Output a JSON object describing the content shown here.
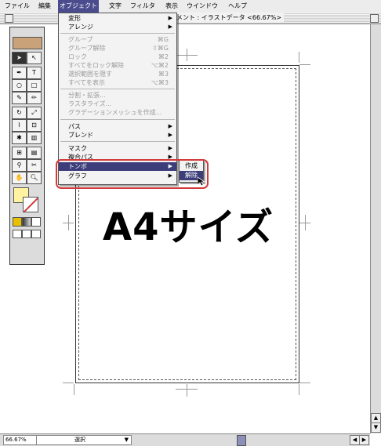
{
  "menubar": {
    "items": [
      {
        "label": "ファイル"
      },
      {
        "label": "編集"
      },
      {
        "label": "オブジェクト"
      },
      {
        "label": "文字"
      },
      {
        "label": "フィルタ"
      },
      {
        "label": "表示"
      },
      {
        "label": "ウインドウ"
      },
      {
        "label": "ヘルプ"
      }
    ]
  },
  "window": {
    "title": "ドキュメント : イラストデータ <66.67%>"
  },
  "menu": {
    "items": [
      {
        "label": "変形",
        "shortcut": "",
        "submenu": true,
        "enabled": true
      },
      {
        "label": "アレンジ",
        "shortcut": "",
        "submenu": true,
        "enabled": true
      },
      {
        "label": "グループ",
        "shortcut": "⌘G",
        "submenu": false,
        "enabled": false
      },
      {
        "label": "グループ解除",
        "shortcut": "⇧⌘G",
        "submenu": false,
        "enabled": false
      },
      {
        "label": "ロック",
        "shortcut": "⌘2",
        "submenu": false,
        "enabled": false
      },
      {
        "label": "すべてをロック解除",
        "shortcut": "⌥⌘2",
        "submenu": false,
        "enabled": false
      },
      {
        "label": "選択範囲を隠す",
        "shortcut": "⌘3",
        "submenu": false,
        "enabled": false
      },
      {
        "label": "すべてを表示",
        "shortcut": "⌥⌘3",
        "submenu": false,
        "enabled": false
      },
      {
        "label": "分割・拡張...",
        "shortcut": "",
        "submenu": false,
        "enabled": false
      },
      {
        "label": "ラスタライズ...",
        "shortcut": "",
        "submenu": false,
        "enabled": false
      },
      {
        "label": "グラデーションメッシュを作成...",
        "shortcut": "",
        "submenu": false,
        "enabled": false
      },
      {
        "label": "パス",
        "shortcut": "",
        "submenu": true,
        "enabled": true
      },
      {
        "label": "ブレンド",
        "shortcut": "",
        "submenu": true,
        "enabled": true
      },
      {
        "label": "マスク",
        "shortcut": "",
        "submenu": true,
        "enabled": true
      },
      {
        "label": "複合パス",
        "shortcut": "",
        "submenu": true,
        "enabled": true
      },
      {
        "label": "トンボ",
        "shortcut": "",
        "submenu": true,
        "enabled": true,
        "highlighted": true
      },
      {
        "label": "グラフ",
        "shortcut": "",
        "submenu": true,
        "enabled": true
      }
    ]
  },
  "submenu": {
    "items": [
      {
        "label": "作成"
      },
      {
        "label": "解除",
        "highlighted": true
      }
    ]
  },
  "canvas": {
    "text": "A4サイズ"
  },
  "statusbar": {
    "zoom": "66.67%",
    "status": "選択"
  },
  "colors": {
    "menu_highlight": "#3c3d7a",
    "callout": "#d23a3a",
    "fill_swatch": "#fff2a0",
    "stroke_swatch": "#d23a3a"
  }
}
